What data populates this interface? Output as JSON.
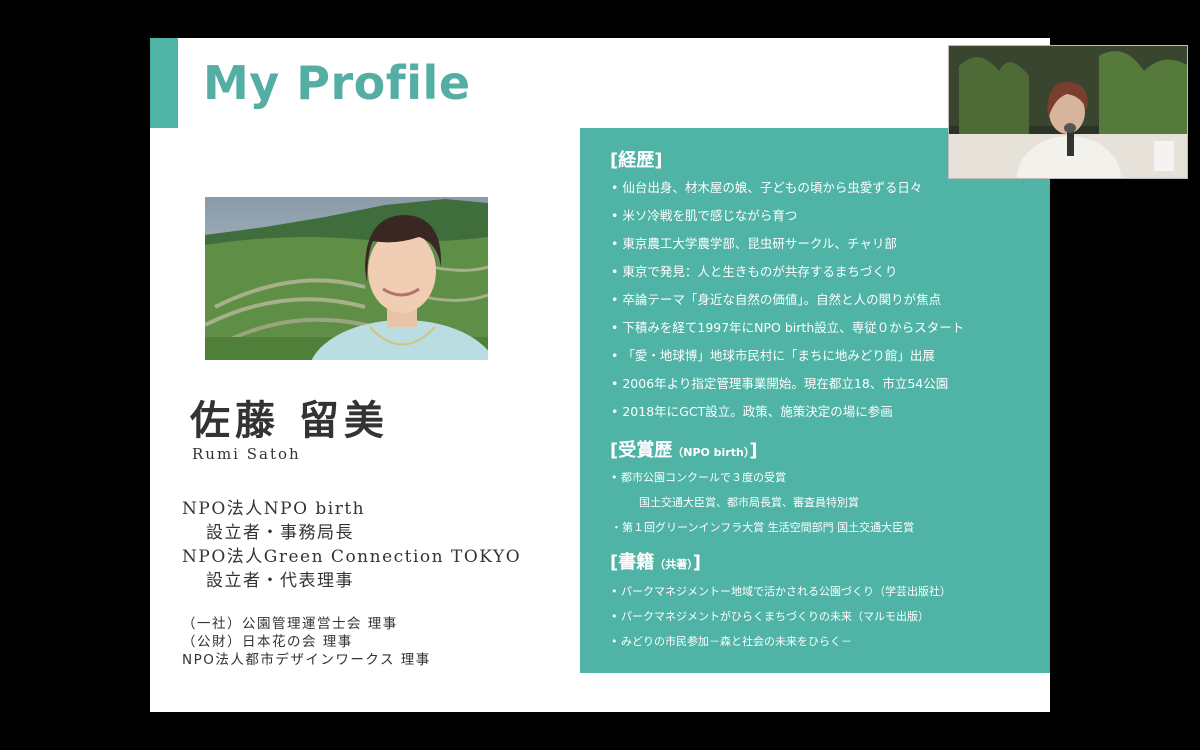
{
  "slide": {
    "title": "My Profile",
    "name_jp": "佐藤 留美",
    "name_en": "Rumi Satoh",
    "roles": [
      "NPO法人NPO birth",
      "設立者・事務局長",
      "NPO法人Green Connection TOKYO",
      "設立者・代表理事"
    ],
    "affiliations": [
      "（一社）公園管理運営士会 理事",
      "（公財）日本花の会 理事",
      "NPO法人都市デザインワークス 理事"
    ],
    "photo_icon": "portrait-photo",
    "accent_color": "#4fb3a6",
    "title_color": "#55aea4"
  },
  "career": {
    "heading": "[経歴]",
    "items": [
      "仙台出身、材木屋の娘、子どもの頃から虫愛ずる日々",
      "米ソ冷戦を肌で感じながら育つ",
      "東京農工大学農学部、昆虫研サークル、チャリ部",
      "東京で発見：人と生きものが共存するまちづくり",
      "卒論テーマ「身近な自然の価値」。自然と人の関りが焦点",
      "下積みを経て1997年にNPO birth設立、専従０からスタート",
      "「愛・地球博」地球市民村に「まちに地みどり館」出展",
      "2006年より指定管理事業開始。現在都立18、市立54公園",
      "2018年にGCT設立。政策、施策決定の場に参画"
    ]
  },
  "awards": {
    "heading": "[受賞歴",
    "heading_note": "（NPO birth）",
    "heading_close": "]",
    "items": [
      "都市公園コンクールで３度の受賞",
      "国土交通大臣賞、都市局長賞、審査員特別賞",
      "第１回グリーンインフラ大賞 生活空間部門 国土交通大臣賞"
    ]
  },
  "books": {
    "heading": "[書籍",
    "heading_note": "（共著）",
    "heading_close": "]",
    "items": [
      "パークマネジメントー地域で活かされる公園づくり（学芸出版社）",
      "パークマネジメントがひらくまちづくりの未来（マルモ出版）",
      "みどりの市民参加－森と社会の未来をひらく－"
    ]
  },
  "video": {
    "icon": "speaker-video"
  }
}
